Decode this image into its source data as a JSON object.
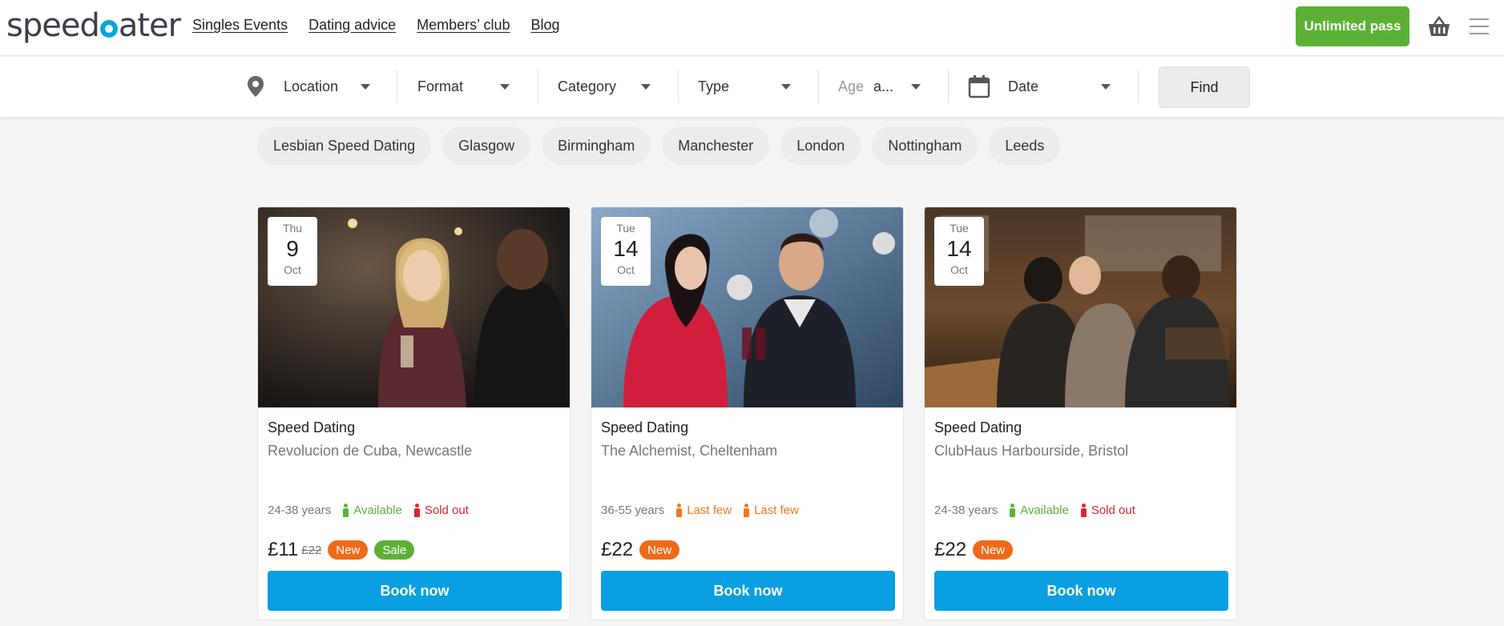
{
  "header": {
    "logo": {
      "before": "speed",
      "after": "ater"
    },
    "nav": [
      "Singles Events",
      "Dating advice",
      "Members’ club",
      "Blog"
    ],
    "unlimited_pass": "Unlimited pass"
  },
  "filters": {
    "location": "Location",
    "format": "Format",
    "category": "Category",
    "type": "Type",
    "age_label": "Age",
    "age_value": "a...",
    "date": "Date",
    "find": "Find"
  },
  "chips": [
    "Lesbian Speed Dating",
    "Glasgow",
    "Birmingham",
    "Manchester",
    "London",
    "Nottingham",
    "Leeds"
  ],
  "colors": {
    "brand_blue": "#0a9ee2",
    "green": "#5cb135",
    "orange": "#f06a1a",
    "red": "#d8262e"
  },
  "cards": [
    {
      "dow": "Thu",
      "day": "9",
      "month": "Oct",
      "title": "Speed Dating",
      "venue": "Revolucion de Cuba, Newcastle",
      "ages": "24-38 years",
      "men": "Available",
      "men_status": "green",
      "women": "Sold out",
      "women_status": "red",
      "price": "£11",
      "old_price": "£22",
      "badges": [
        "New",
        "Sale"
      ],
      "book": "Book now"
    },
    {
      "dow": "Tue",
      "day": "14",
      "month": "Oct",
      "title": "Speed Dating",
      "venue": "The Alchemist, Cheltenham",
      "ages": "36-55 years",
      "men": "Last few",
      "men_status": "orange",
      "women": "Last few",
      "women_status": "orange",
      "price": "£22",
      "old_price": "",
      "badges": [
        "New"
      ],
      "book": "Book now"
    },
    {
      "dow": "Tue",
      "day": "14",
      "month": "Oct",
      "title": "Speed Dating",
      "venue": "ClubHaus Harbourside, Bristol",
      "ages": "24-38 years",
      "men": "Available",
      "men_status": "green",
      "women": "Sold out",
      "women_status": "red",
      "price": "£22",
      "old_price": "",
      "badges": [
        "New"
      ],
      "book": "Book now"
    }
  ]
}
